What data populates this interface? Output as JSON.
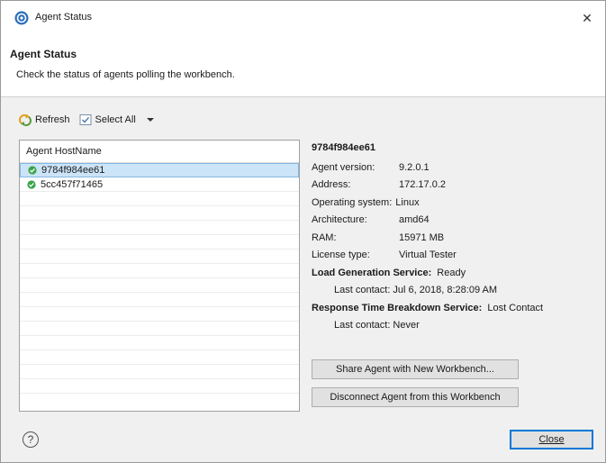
{
  "window": {
    "title": "Agent Status",
    "close_glyph": "✕"
  },
  "header": {
    "title": "Agent Status",
    "description": "Check the status of agents polling the workbench."
  },
  "toolbar": {
    "refresh_label": "Refresh",
    "select_all_label": "Select All"
  },
  "agent_list": {
    "column_header": "Agent HostName",
    "agents": [
      {
        "name": "9784f984ee61",
        "status_icon": "green-check-icon",
        "selected": true
      },
      {
        "name": "5cc457f71465",
        "status_icon": "green-check-icon",
        "selected": false
      }
    ]
  },
  "details": {
    "hostname": "9784f984ee61",
    "fields": [
      {
        "label": "Agent version:",
        "value": "9.2.0.1"
      },
      {
        "label": "Address:",
        "value": "172.17.0.2"
      },
      {
        "label": "Operating system:",
        "value": "Linux"
      },
      {
        "label": "Architecture:",
        "value": "amd64"
      },
      {
        "label": "RAM:",
        "value": "15971 MB"
      },
      {
        "label": "License type:",
        "value": "Virtual Tester"
      }
    ],
    "load_generation": {
      "label": "Load Generation Service:",
      "status": "Ready",
      "last_contact": "Last contact: Jul 6, 2018, 8:28:09 AM"
    },
    "response_time": {
      "label": "Response Time Breakdown Service:",
      "status": "Lost Contact",
      "last_contact": "Last contact: Never"
    }
  },
  "buttons": {
    "share": "Share Agent with New Workbench...",
    "disconnect": "Disconnect Agent from this Workbench",
    "close": "Close",
    "help_glyph": "?"
  },
  "colors": {
    "accent": "#0078d7",
    "ok_green": "#3aa54a",
    "selection": "#cce4f7"
  }
}
